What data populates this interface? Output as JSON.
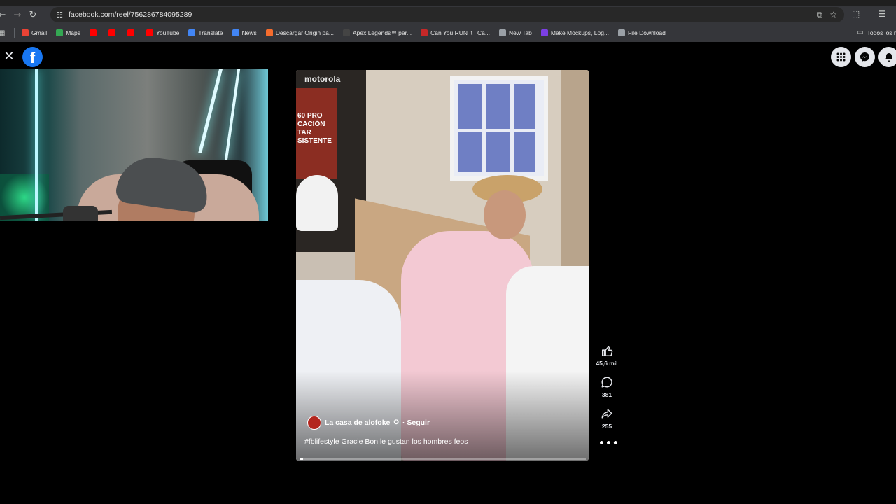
{
  "browser": {
    "url": "facebook.com/reel/756286784095289",
    "bookmarks": [
      {
        "label": "Gmail",
        "color": "#ea4335"
      },
      {
        "label": "Maps",
        "color": "#34a853"
      },
      {
        "label": "",
        "color": "#ff0000"
      },
      {
        "label": "",
        "color": "#ff0000"
      },
      {
        "label": "",
        "color": "#ff0000"
      },
      {
        "label": "YouTube",
        "color": "#ff0000"
      },
      {
        "label": "Translate",
        "color": "#4285f4"
      },
      {
        "label": "News",
        "color": "#4285f4"
      },
      {
        "label": "Descargar Origin pa...",
        "color": "#f56c2d"
      },
      {
        "label": "Apex Legends™ par...",
        "color": "#444444"
      },
      {
        "label": "Can You RUN It | Ca...",
        "color": "#c62828"
      },
      {
        "label": "New Tab",
        "color": "#9aa0a6"
      },
      {
        "label": "Make Mockups, Log...",
        "color": "#7b3fe4"
      },
      {
        "label": "File Download",
        "color": "#9aa0a6"
      }
    ],
    "all_bookmarks_label": "Todos los m"
  },
  "facebook": {
    "logo_letter": "f"
  },
  "reel": {
    "brand_overlay": "motorola",
    "promo_text": "60 PRO\nCACIÓN\nTAR\nSISTENTE",
    "author": "La casa de alofoke",
    "follow_label": "· Seguir",
    "caption": "#fblifestyle Gracie Bon le gustan los hombres feos",
    "progress_fraction": 0.01,
    "likes": "45,6 mil",
    "comments": "381",
    "shares": "255"
  },
  "colors": {
    "fb_blue": "#1877f2",
    "chrome_bar": "#35363a",
    "omnibox": "#282828"
  }
}
